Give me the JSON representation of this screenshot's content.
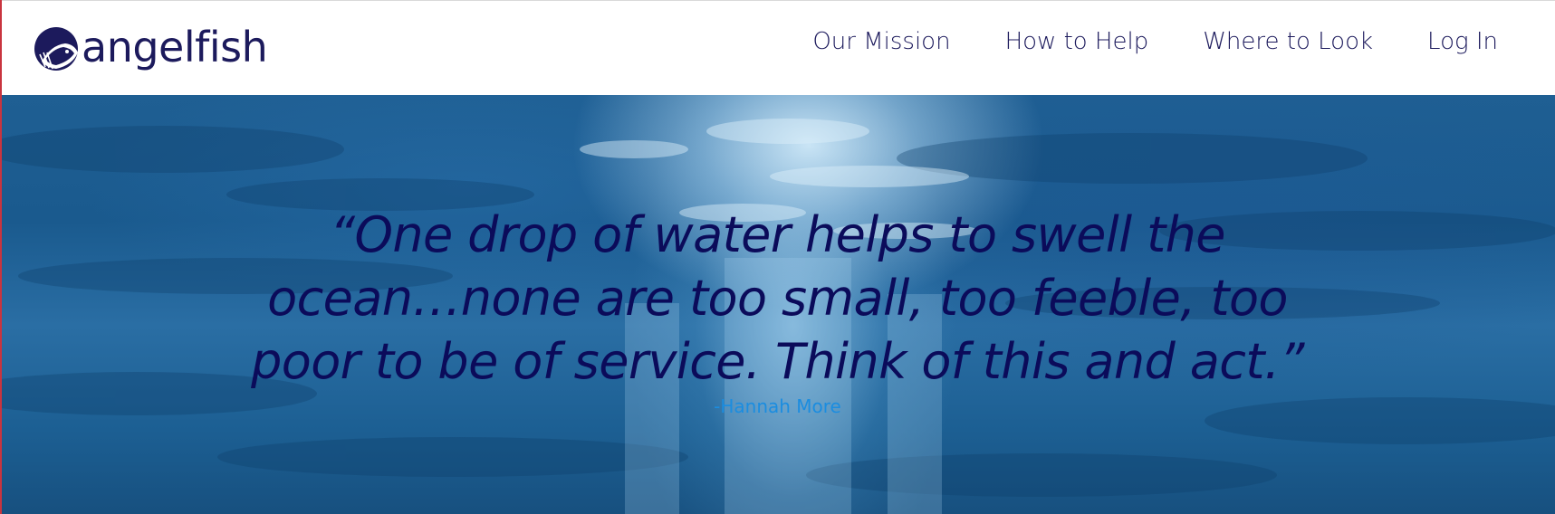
{
  "brand": {
    "name": "angelfish",
    "logo_icon": "angelfish-logo-icon",
    "color": "#1c1a5c"
  },
  "nav": {
    "items": [
      {
        "label": "Our Mission"
      },
      {
        "label": "How to Help"
      },
      {
        "label": "Where to Look"
      },
      {
        "label": "Log In"
      }
    ]
  },
  "hero": {
    "quote_lines": [
      "“One drop of water helps to swell the",
      "ocean…none are too small, too feeble, too",
      "poor to be of service. Think of this and act.”"
    ],
    "author": "-Hannah More",
    "quote_color": "#0b0b5a",
    "author_color": "#1b8de0"
  }
}
